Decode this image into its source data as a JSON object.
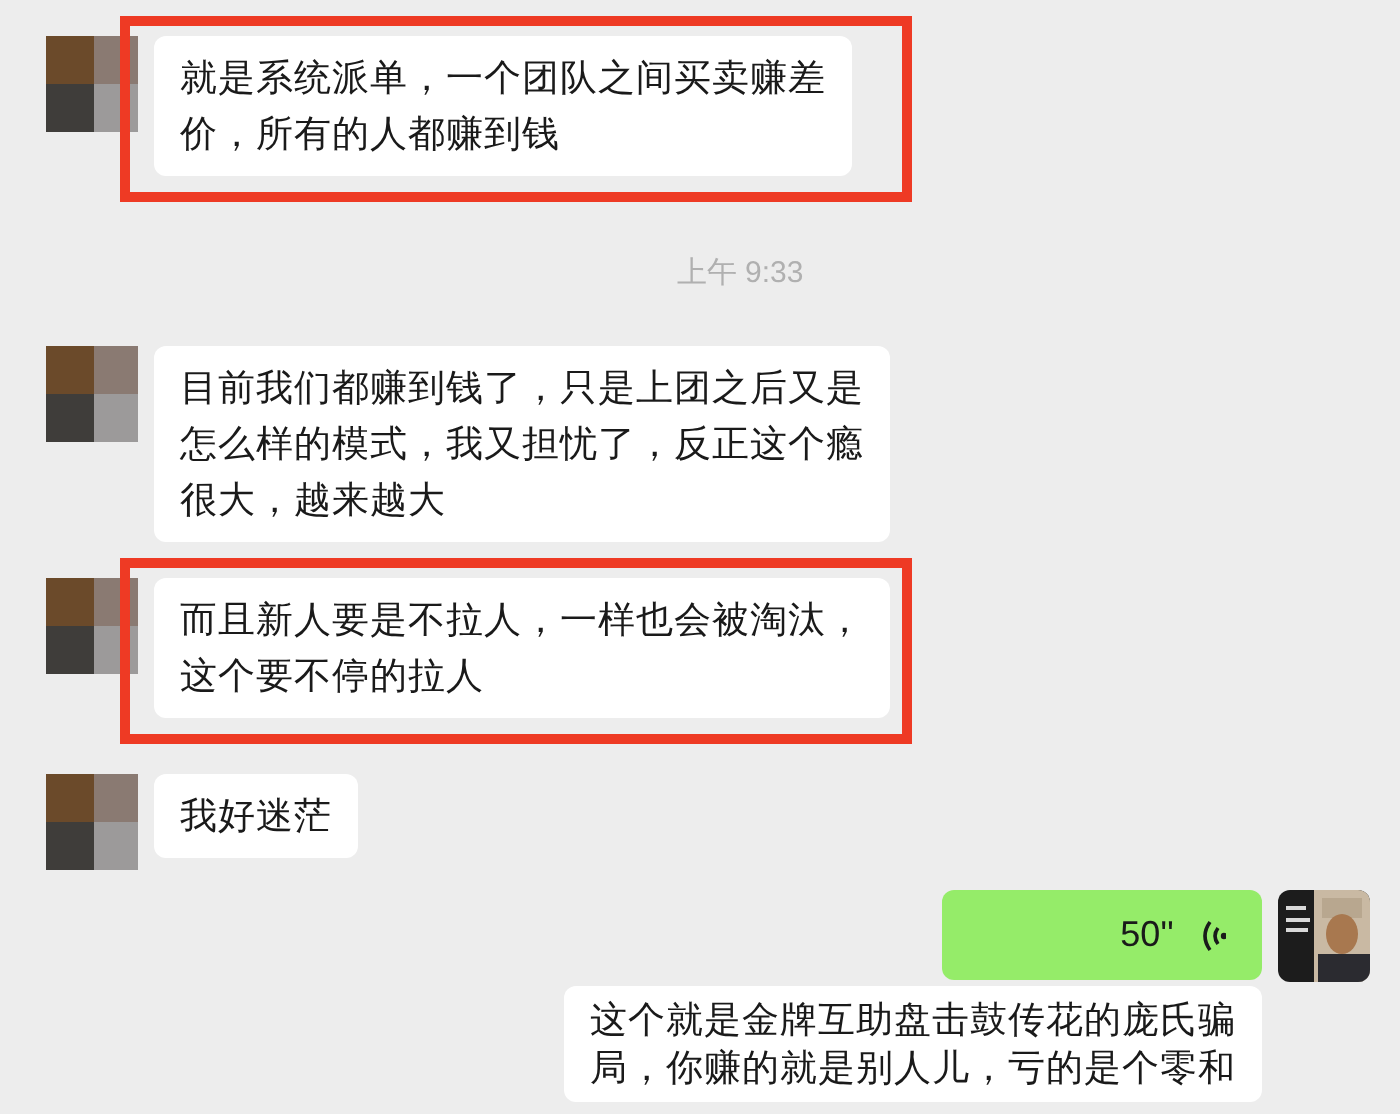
{
  "messages": [
    {
      "kind": "text",
      "outgoing": false,
      "highlighted": true,
      "lines": [
        "就是系统派单，一个团队之间买卖赚差",
        "价，所有的人都赚到钱"
      ]
    },
    {
      "kind": "time",
      "text": "上午 9:33"
    },
    {
      "kind": "text",
      "outgoing": false,
      "highlighted": false,
      "lines": [
        "目前我们都赚到钱了，只是上团之后又是",
        "怎么样的模式，我又担忧了，反正这个瘾",
        "很大，越来越大"
      ]
    },
    {
      "kind": "text",
      "outgoing": false,
      "highlighted": true,
      "lines": [
        "而且新人要是不拉人，一样也会被淘汰，",
        "这个要不停的拉人"
      ]
    },
    {
      "kind": "text",
      "outgoing": false,
      "highlighted": false,
      "lines": [
        "我好迷茫"
      ]
    },
    {
      "kind": "voice",
      "outgoing": true,
      "duration": "50''"
    },
    {
      "kind": "text",
      "outgoing": true,
      "highlighted": false,
      "lines": [
        "这个就是金牌互助盘击鼓传花的庞氏骗",
        "局，你赚的就是别人儿，亏的是个零和"
      ]
    }
  ]
}
